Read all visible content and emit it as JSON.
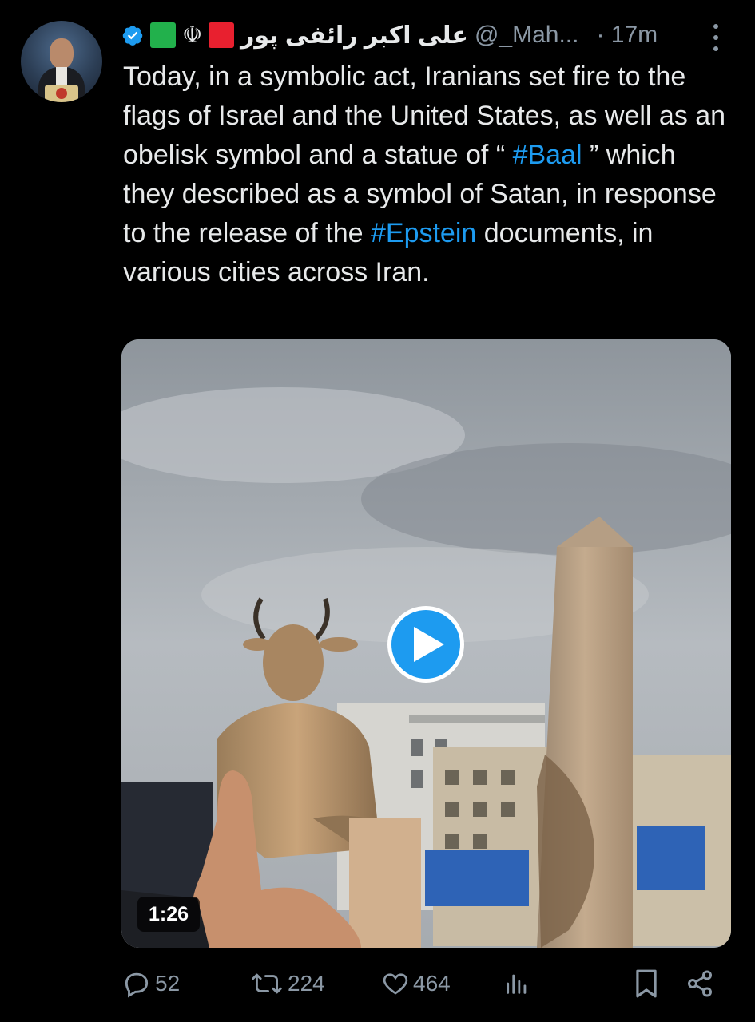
{
  "author": {
    "name": "علی اکبر رائفی پور",
    "handle": "@_Mah...",
    "time": "· 17m",
    "emblem_glyph": "☫"
  },
  "tweet": {
    "text_parts": [
      "Today, in a symbolic act, Iranians set fire to the flags of Israel and the United States, as well as an obelisk symbol and a statue of “ ",
      "#Baal",
      " ” which they described as a symbol of Satan, in response to the release of the ",
      "#Epstein",
      " documents, in various cities across Iran."
    ]
  },
  "media": {
    "duration": "1:26",
    "play_icon": "play-icon"
  },
  "actions": {
    "replies": "52",
    "reposts": "224",
    "likes": "464"
  },
  "colors": {
    "accent": "#1d9bf0",
    "text": "#e7e9ea",
    "muted": "#8b98a5",
    "background": "#000000"
  }
}
